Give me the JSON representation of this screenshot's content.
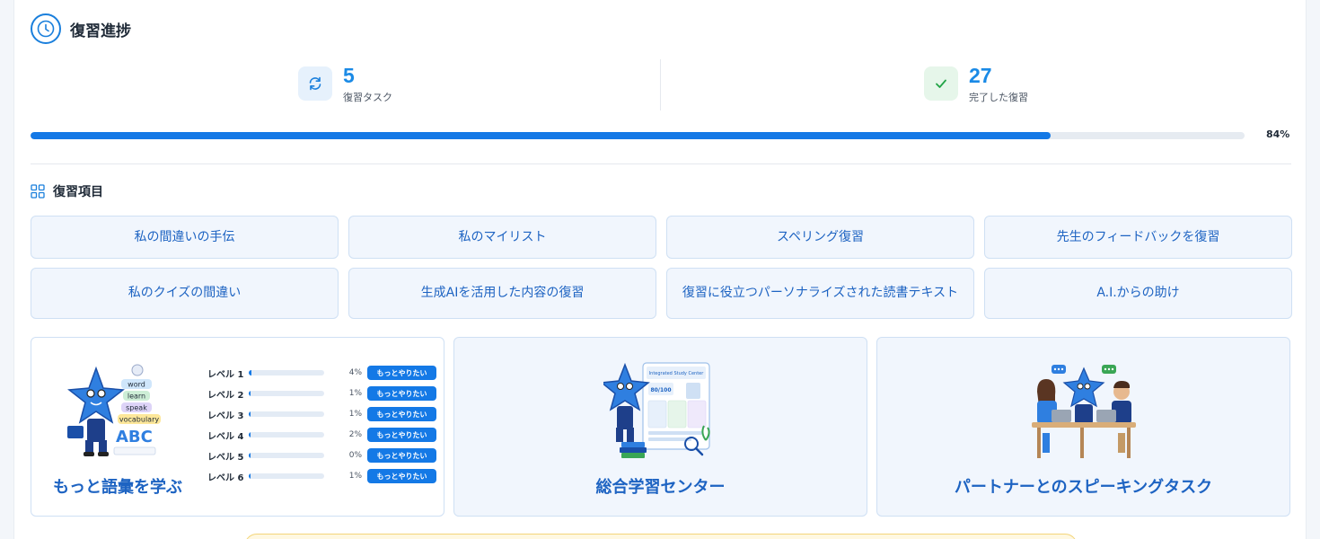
{
  "header": {
    "title": "復習進捗",
    "icon": "clock-icon"
  },
  "stats": [
    {
      "icon": "refresh-icon",
      "value": "5",
      "label": "復習タスク"
    },
    {
      "icon": "check-icon",
      "value": "27",
      "label": "完了した復習"
    }
  ],
  "progress": {
    "percent": 84,
    "label": "84%"
  },
  "section": {
    "title": "復習項目",
    "icon": "grid-icon"
  },
  "review_items": [
    "私の間違いの手伝",
    "私のマイリスト",
    "スペリング復習",
    "先生のフィードバックを復習",
    "私のクイズの間違い",
    "生成AIを活用した内容の復習",
    "復習に役立つパーソナライズされた読書テキスト",
    "A.I.からの助け"
  ],
  "vocab_panel": {
    "title": "もっと語彙を学ぶ",
    "illustration_words": [
      "word",
      "learn",
      "speak",
      "vocabulary",
      "ABC"
    ],
    "levels": [
      {
        "label": "レベル 1",
        "percent": 4,
        "pct_label": "4%",
        "button": "もっとやりたい"
      },
      {
        "label": "レベル 2",
        "percent": 1,
        "pct_label": "1%",
        "button": "もっとやりたい"
      },
      {
        "label": "レベル 3",
        "percent": 1,
        "pct_label": "1%",
        "button": "もっとやりたい"
      },
      {
        "label": "レベル 4",
        "percent": 2,
        "pct_label": "2%",
        "button": "もっとやりたい"
      },
      {
        "label": "レベル 5",
        "percent": 0,
        "pct_label": "0%",
        "button": "もっとやりたい"
      },
      {
        "label": "レベル 6",
        "percent": 1,
        "pct_label": "1%",
        "button": "もっとやりたい"
      }
    ]
  },
  "study_panel": {
    "title": "総合学習センター",
    "illustration_text": [
      "Integrated Study Center",
      "80/100"
    ]
  },
  "speaking_panel": {
    "title": "パートナーとのスピーキングタスク"
  },
  "colors": {
    "accent": "#1479e6",
    "number": "#1a8ae6",
    "tile_bg": "#f1f6fd",
    "tile_border": "#cfe0f4",
    "success": "#22a447"
  }
}
